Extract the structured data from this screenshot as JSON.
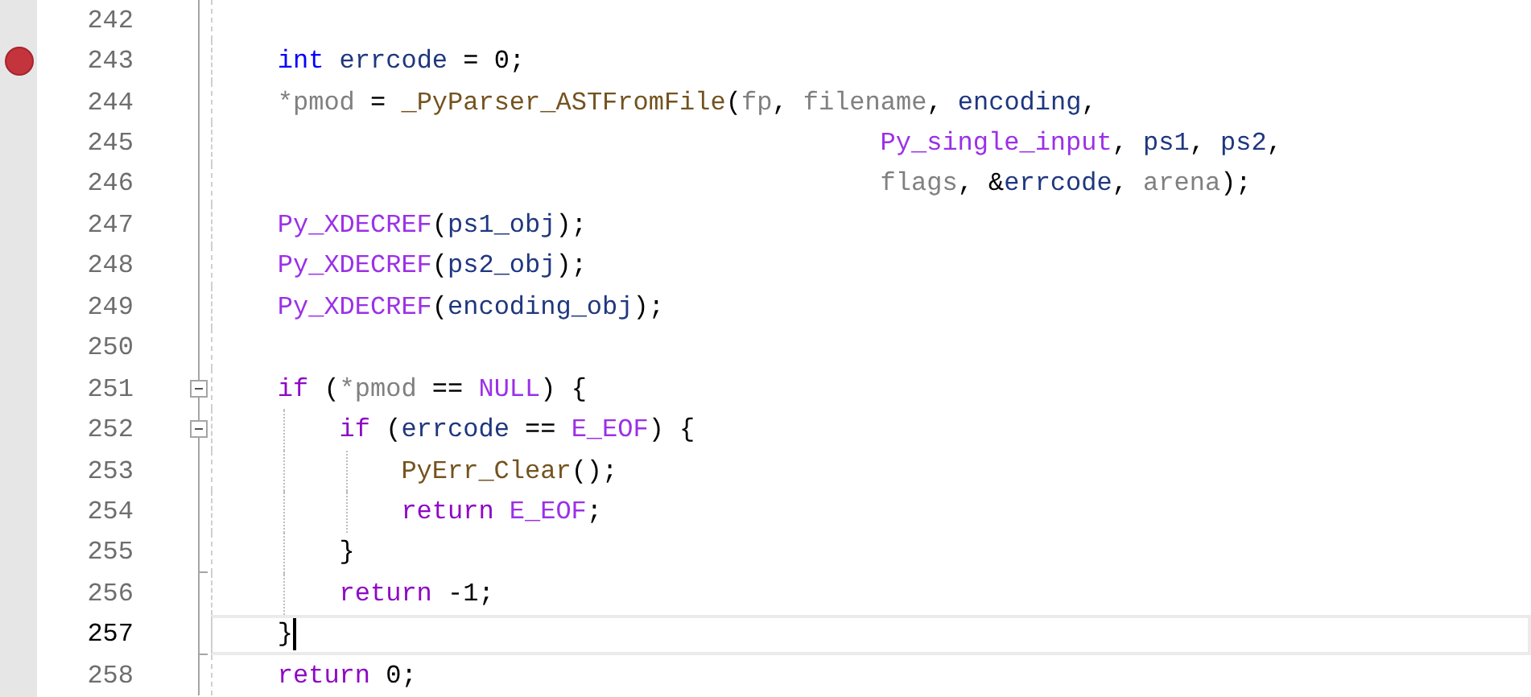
{
  "editor": {
    "lines": [
      {
        "number": "242",
        "breakpoint": false,
        "current": false,
        "fold": false,
        "fold_end": false
      },
      {
        "number": "243",
        "breakpoint": true,
        "current": false,
        "fold": false,
        "fold_end": false,
        "tokens": [
          {
            "text": "    int",
            "kind": "keyword"
          },
          {
            "text": " errcode",
            "kind": "local"
          },
          {
            "text": " = 0;",
            "kind": "plain"
          }
        ]
      },
      {
        "number": "244",
        "breakpoint": false,
        "current": false,
        "fold": false,
        "fold_end": false,
        "tokens": [
          {
            "text": "    *pmod",
            "kind": "param"
          },
          {
            "text": " = ",
            "kind": "plain"
          },
          {
            "text": "_PyParser_ASTFromFile",
            "kind": "function"
          },
          {
            "text": "(",
            "kind": "plain"
          },
          {
            "text": "fp",
            "kind": "param"
          },
          {
            "text": ", ",
            "kind": "plain"
          },
          {
            "text": "filename",
            "kind": "param"
          },
          {
            "text": ", ",
            "kind": "plain"
          },
          {
            "text": "encoding",
            "kind": "local"
          },
          {
            "text": ",",
            "kind": "plain"
          }
        ]
      },
      {
        "number": "245",
        "breakpoint": false,
        "current": false,
        "fold": false,
        "fold_end": false,
        "tokens": [
          {
            "text": "                                           Py_single_input",
            "kind": "macro"
          },
          {
            "text": ", ",
            "kind": "plain"
          },
          {
            "text": "ps1",
            "kind": "local"
          },
          {
            "text": ", ",
            "kind": "plain"
          },
          {
            "text": "ps2",
            "kind": "local"
          },
          {
            "text": ",",
            "kind": "plain"
          }
        ]
      },
      {
        "number": "246",
        "breakpoint": false,
        "current": false,
        "fold": false,
        "fold_end": false,
        "tokens": [
          {
            "text": "                                           flags",
            "kind": "param"
          },
          {
            "text": ", &",
            "kind": "plain"
          },
          {
            "text": "errcode",
            "kind": "local"
          },
          {
            "text": ", ",
            "kind": "plain"
          },
          {
            "text": "arena",
            "kind": "param"
          },
          {
            "text": ");",
            "kind": "plain"
          }
        ]
      },
      {
        "number": "247",
        "breakpoint": false,
        "current": false,
        "fold": false,
        "fold_end": false,
        "tokens": [
          {
            "text": "    Py_XDECREF",
            "kind": "macro"
          },
          {
            "text": "(",
            "kind": "plain"
          },
          {
            "text": "ps1_obj",
            "kind": "local"
          },
          {
            "text": ");",
            "kind": "plain"
          }
        ]
      },
      {
        "number": "248",
        "breakpoint": false,
        "current": false,
        "fold": false,
        "fold_end": false,
        "tokens": [
          {
            "text": "    Py_XDECREF",
            "kind": "macro"
          },
          {
            "text": "(",
            "kind": "plain"
          },
          {
            "text": "ps2_obj",
            "kind": "local"
          },
          {
            "text": ");",
            "kind": "plain"
          }
        ]
      },
      {
        "number": "249",
        "breakpoint": false,
        "current": false,
        "fold": false,
        "fold_end": false,
        "tokens": [
          {
            "text": "    Py_XDECREF",
            "kind": "macro"
          },
          {
            "text": "(",
            "kind": "plain"
          },
          {
            "text": "encoding_obj",
            "kind": "local"
          },
          {
            "text": ");",
            "kind": "plain"
          }
        ]
      },
      {
        "number": "250",
        "breakpoint": false,
        "current": false,
        "fold": false,
        "fold_end": false
      },
      {
        "number": "251",
        "breakpoint": false,
        "current": false,
        "fold": true,
        "fold_end": false,
        "tokens": [
          {
            "text": "    if",
            "kind": "control"
          },
          {
            "text": " (",
            "kind": "plain"
          },
          {
            "text": "*pmod",
            "kind": "param"
          },
          {
            "text": " == ",
            "kind": "plain"
          },
          {
            "text": "NULL",
            "kind": "macro"
          },
          {
            "text": ") {",
            "kind": "plain"
          }
        ]
      },
      {
        "number": "252",
        "breakpoint": false,
        "current": false,
        "fold": true,
        "fold_end": false,
        "tokens": [
          {
            "text": "        if",
            "kind": "control"
          },
          {
            "text": " (",
            "kind": "plain"
          },
          {
            "text": "errcode",
            "kind": "local"
          },
          {
            "text": " == ",
            "kind": "plain"
          },
          {
            "text": "E_EOF",
            "kind": "macro"
          },
          {
            "text": ") {",
            "kind": "plain"
          }
        ]
      },
      {
        "number": "253",
        "breakpoint": false,
        "current": false,
        "fold": false,
        "fold_end": false,
        "tokens": [
          {
            "text": "            PyErr_Clear",
            "kind": "function"
          },
          {
            "text": "();",
            "kind": "plain"
          }
        ]
      },
      {
        "number": "254",
        "breakpoint": false,
        "current": false,
        "fold": false,
        "fold_end": false,
        "tokens": [
          {
            "text": "            return",
            "kind": "control"
          },
          {
            "text": " E_EOF",
            "kind": "macro"
          },
          {
            "text": ";",
            "kind": "plain"
          }
        ]
      },
      {
        "number": "255",
        "breakpoint": false,
        "current": false,
        "fold": false,
        "fold_end": true,
        "tokens": [
          {
            "text": "        }",
            "kind": "plain"
          }
        ]
      },
      {
        "number": "256",
        "breakpoint": false,
        "current": false,
        "fold": false,
        "fold_end": false,
        "tokens": [
          {
            "text": "        return",
            "kind": "control"
          },
          {
            "text": " -1;",
            "kind": "plain"
          }
        ]
      },
      {
        "number": "257",
        "breakpoint": false,
        "current": true,
        "fold": false,
        "fold_end": true,
        "tokens": [
          {
            "text": "    }",
            "kind": "plain"
          }
        ]
      },
      {
        "number": "258",
        "breakpoint": false,
        "current": false,
        "fold": false,
        "fold_end": false,
        "tokens": [
          {
            "text": "    return",
            "kind": "control"
          },
          {
            "text": " 0;",
            "kind": "plain"
          }
        ]
      }
    ]
  }
}
